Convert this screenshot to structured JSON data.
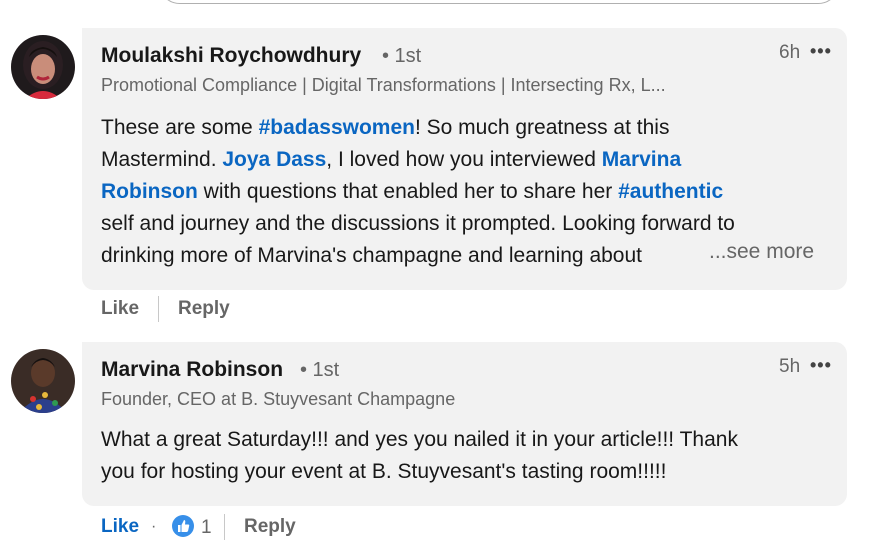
{
  "colors": {
    "link": "#0a66c2",
    "bubble": "#f2f2f2",
    "muted": "#666666",
    "like_reaction": "#378fe9"
  },
  "comments": [
    {
      "name": "Moulakshi Roychowdhury",
      "degree": "• 1st",
      "headline": "Promotional Compliance | Digital Transformations | Intersecting Rx, L...",
      "time": "6h",
      "menu": "•••",
      "body": {
        "l1_a": "These are some ",
        "l1_link": "#badasswomen",
        "l1_b": "! So much greatness at this",
        "l2_a": "Mastermind. ",
        "l2_link1": "Joya Dass",
        "l2_b": ", I loved how you interviewed ",
        "l2_link2": "Marvina",
        "l3_link": "Robinson",
        "l3_a": " with questions that enabled her to share her ",
        "l3_link2": "#authentic",
        "l4": "self and journey and the discussions it prompted. Looking forward to",
        "l5": "drinking more of Marvina's champagne and learning about"
      },
      "see_more": "...see more",
      "actions": {
        "like": "Like",
        "reply": "Reply"
      }
    },
    {
      "name": "Marvina Robinson",
      "degree": "• 1st",
      "headline": "Founder, CEO at B. Stuyvesant Champagne",
      "time": "5h",
      "menu": "•••",
      "body": {
        "l1": "What a great Saturday!!! and yes you nailed it in your article!!! Thank",
        "l2": "you for hosting your event at B. Stuyvesant's tasting room!!!!!"
      },
      "actions": {
        "like": "Like",
        "separator": "·",
        "reaction_icon": "thumbs-up-icon",
        "reaction_count": "1",
        "reply": "Reply"
      }
    }
  ]
}
